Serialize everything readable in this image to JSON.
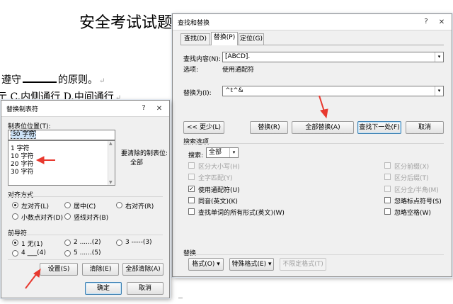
{
  "document": {
    "title": "安全考试试题",
    "line1_prefix": "遵守",
    "line1_suffix": "的原则。",
    "line2": "亍 C.内侧通行 D.中间通行"
  },
  "find_replace": {
    "title": "查找和替换",
    "help": "?",
    "close": "✕",
    "tabs": [
      "查找(D)",
      "替换(P)",
      "定位(G)"
    ],
    "find_label": "查找内容(N):",
    "find_value": "[ABCD].",
    "options_label": "选项:",
    "options_value": "使用通配符",
    "replace_label": "替换为(I):",
    "replace_value": "^t^&",
    "less_button": "<< 更少(L)",
    "replace_button": "替换(R)",
    "replace_all_button": "全部替换(A)",
    "find_next_button": "查找下一处(F)",
    "cancel_button": "取消",
    "search_options_title": "搜索选项",
    "search_label": "搜索:",
    "search_value": "全部",
    "left_options": [
      {
        "label": "区分大小写(H)",
        "checked": false,
        "disabled": true
      },
      {
        "label": "全字匹配(Y)",
        "checked": false,
        "disabled": true
      },
      {
        "label": "使用通配符(U)",
        "checked": true,
        "disabled": false
      },
      {
        "label": "同音(英文)(K)",
        "checked": false,
        "disabled": false
      },
      {
        "label": "查找单词的所有形式(英文)(W)",
        "checked": false,
        "disabled": false
      }
    ],
    "right_options": [
      {
        "label": "区分前缀(X)",
        "checked": false,
        "disabled": true
      },
      {
        "label": "区分后缀(T)",
        "checked": false,
        "disabled": true
      },
      {
        "label": "区分全/半角(M)",
        "checked": false,
        "disabled": true
      },
      {
        "label": "忽略标点符号(S)",
        "checked": false,
        "disabled": false
      },
      {
        "label": "忽略空格(W)",
        "checked": false,
        "disabled": false
      }
    ],
    "replace_section_title": "替换",
    "format_button": "格式(O) ▾",
    "special_button": "特殊格式(E) ▾",
    "no_format_button": "不限定格式(T)"
  },
  "tabs_dialog": {
    "title": "替换制表符",
    "help": "?",
    "close": "✕",
    "position_label": "制表位位置(T):",
    "position_value": "30 字符",
    "list_items": [
      "1 字符",
      "10 字符",
      "20 字符",
      "30 字符"
    ],
    "to_clear_label": "要清除的制表位:",
    "to_clear_value": "全部",
    "alignment_title": "对齐方式",
    "alignments": [
      {
        "label": "左对齐(L)",
        "selected": true
      },
      {
        "label": "居中(C)",
        "selected": false
      },
      {
        "label": "右对齐(R)",
        "selected": false
      },
      {
        "label": "小数点对齐(D)",
        "selected": false
      },
      {
        "label": "竖线对齐(B)",
        "selected": false
      }
    ],
    "leader_title": "前导符",
    "leaders": [
      {
        "label": "1 无(1)",
        "selected": true
      },
      {
        "label": "2 ......(2)",
        "selected": false
      },
      {
        "label": "3 -----(3)",
        "selected": false
      },
      {
        "label": "4 ___(4)",
        "selected": false
      },
      {
        "label": "5 ......(5)",
        "selected": false
      }
    ],
    "set_button": "设置(S)",
    "clear_button": "清除(E)",
    "clear_all_button": "全部清除(A)",
    "ok_button": "确定",
    "cancel_button": "取消"
  },
  "colors": {
    "annotation_arrow": "#e8392f",
    "dialog_bg": "#f0f0f0"
  }
}
